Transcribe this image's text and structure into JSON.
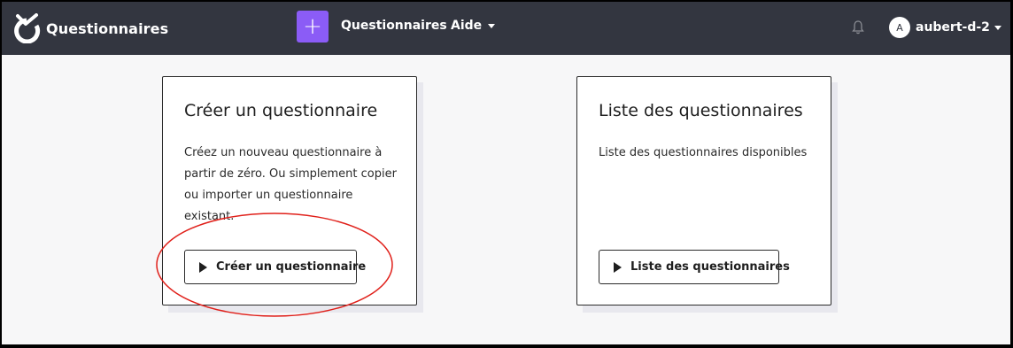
{
  "navbar": {
    "brand": "Questionnaires",
    "plus_icon": "plus-icon",
    "links": {
      "questionnaires": "Questionnaires",
      "aide": "Aide"
    },
    "bell_icon": "bell-icon",
    "user": {
      "avatar_initial": "A",
      "name": "aubert-d-2"
    }
  },
  "cards": {
    "create": {
      "title": "Créer un questionnaire",
      "text": "Créez un nouveau questionnaire à partir de zéro. Ou simplement copier ou importer un questionnaire existant.",
      "button": "Créer un questionnaire"
    },
    "list": {
      "title": "Liste des questionnaires",
      "text": "Liste des questionnaires disponibles",
      "button": "Liste des questionnaires"
    }
  },
  "colors": {
    "navbar_bg": "#333640",
    "accent": "#8b5cf6",
    "annotation": "#e0201a"
  }
}
